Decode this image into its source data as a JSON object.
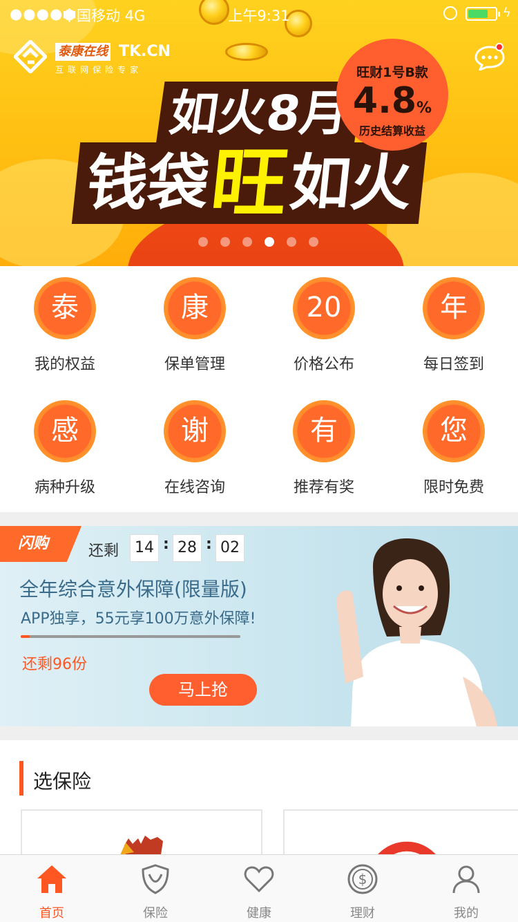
{
  "status_bar": {
    "signal": "●●●●●",
    "carrier": "中国移动  4G",
    "time": "上午9:31"
  },
  "brand": {
    "name_cn": "泰康在线",
    "name_en": "TK.CN",
    "slogan": "互联网保险专家"
  },
  "banner": {
    "line1": "如火8月",
    "line2_a": "钱袋",
    "line2_highlight": "旺",
    "line2_b": "如火",
    "badge_title": "旺财1号B款",
    "badge_value": "4.8",
    "badge_unit": "%",
    "badge_sub": "历史结算收益",
    "page_count": 6,
    "active_page": 3
  },
  "grid": {
    "items": [
      {
        "icon_char": "泰",
        "label": "我的权益"
      },
      {
        "icon_char": "康",
        "label": "保单管理"
      },
      {
        "icon_char": "20",
        "label": "价格公布"
      },
      {
        "icon_char": "年",
        "label": "每日签到"
      },
      {
        "icon_char": "感",
        "label": "病种升级"
      },
      {
        "icon_char": "谢",
        "label": "在线咨询"
      },
      {
        "icon_char": "有",
        "label": "推荐有奖"
      },
      {
        "icon_char": "您",
        "label": "限时免费"
      }
    ]
  },
  "flash_sale": {
    "tag": "闪购",
    "remain_label": "还剩",
    "hours": "14",
    "minutes": "28",
    "seconds": "02",
    "title": "全年综合意外保障(限量版)",
    "subtitle": "APP独享，55元享100万意外保障!",
    "progress": 0.04,
    "left_text": "还剩96份",
    "button": "马上抢"
  },
  "section": {
    "title": "选保险"
  },
  "tabbar": {
    "tabs": [
      {
        "label": "首页",
        "icon": "home-icon",
        "active": true
      },
      {
        "label": "保险",
        "icon": "shield-icon",
        "active": false
      },
      {
        "label": "健康",
        "icon": "heart-icon",
        "active": false
      },
      {
        "label": "理财",
        "icon": "dollar-coin-icon",
        "active": false
      },
      {
        "label": "我的",
        "icon": "user-icon",
        "active": false
      }
    ]
  },
  "colors": {
    "accent": "#ff5722",
    "banner_yellow": "#ffc51a",
    "flash_bg": "#cde7f0"
  }
}
